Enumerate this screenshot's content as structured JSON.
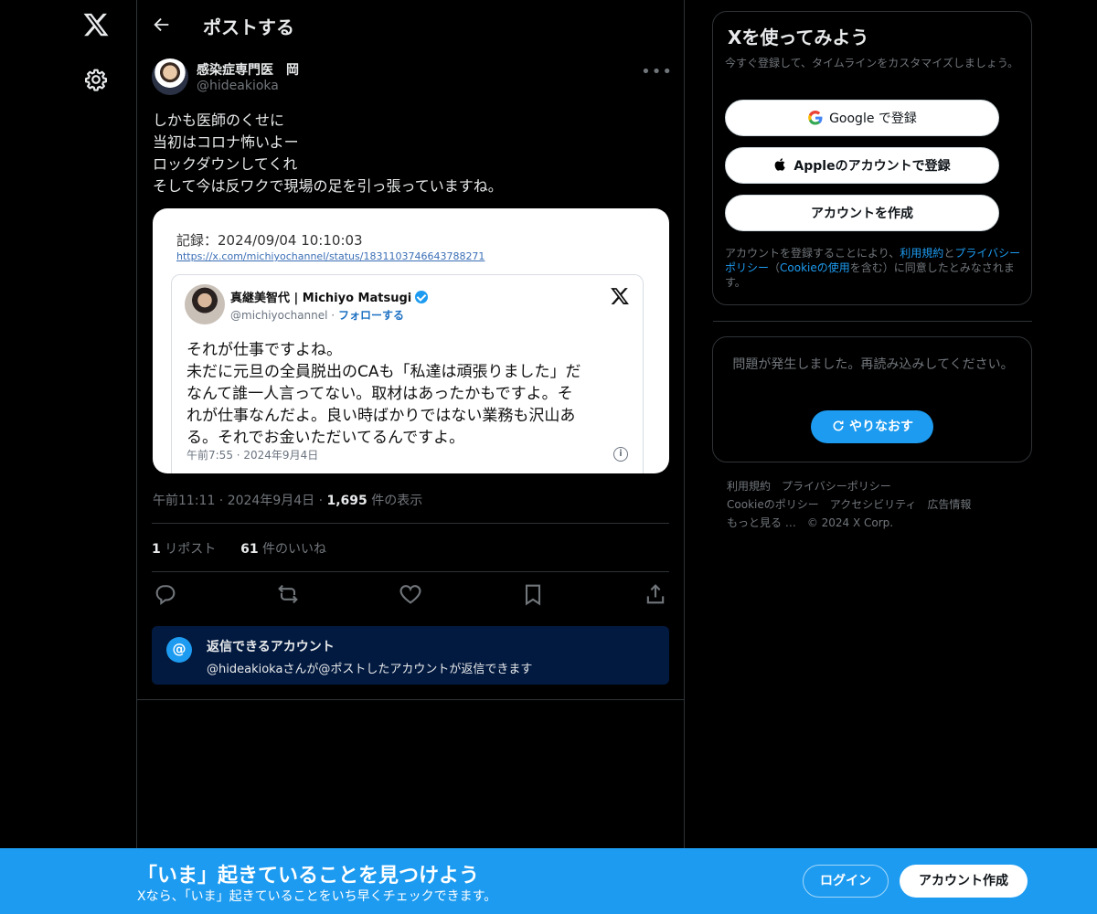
{
  "header": {
    "title": "ポストする"
  },
  "post": {
    "author_name": "感染症専門医　岡",
    "author_handle": "@hideakioka",
    "lines": [
      "しかも医師のくせに",
      "当初はコロナ怖いよー",
      "ロックダウンしてくれ",
      "そして今は反ワクで現場の足を引っ張っていますね。"
    ],
    "meta_time": "午前11:11 · 2024年9月4日 · ",
    "views_count": "1,695",
    "views_label": " 件の表示",
    "reposts_count": "1",
    "reposts_label": " リポスト",
    "likes_count": "61",
    "likes_label": " 件のいいね"
  },
  "media": {
    "record": "記録：2024/09/04 10:10:03",
    "url": "https://x.com/michiyochannel/status/1831103746643788271",
    "name": "真継美智代 | Michiyo Matsugi",
    "handle": "@michiyochannel · ",
    "follow": "フォローする",
    "text_lines": [
      "それが仕事ですよね。",
      "未だに元旦の全員脱出のCAも「私達は頑張りました」だ",
      "なんて誰一人言ってない。取材はあったかもですよ。そ",
      "れが仕事なんだよ。良い時ばかりではない業務も沢山あ",
      "る。それでお金いただいてるんですよ。"
    ],
    "time": "午前7:55 · 2024年9月4日"
  },
  "reply_restriction": {
    "title": "返信できるアカウント",
    "subtitle": "@hideakiokaさんが@ポストしたアカウントが返信できます"
  },
  "signup": {
    "title": "Xを使ってみよう",
    "subtitle": "今すぐ登録して、タイムラインをカスタマイズしましょう。",
    "google_label": "Google で登録",
    "apple_label": "Appleのアカウントで登録",
    "create_label": "アカウントを作成",
    "legal_prefix": "アカウントを登録することにより、",
    "legal_terms": "利用規約",
    "legal_and": "と",
    "legal_privacy": "プライバシーポリシー",
    "legal_paren_open": "（",
    "legal_cookie": "Cookieの使用",
    "legal_suffix": "を含む）に同意したとみなされます。"
  },
  "error": {
    "message": "問題が発生しました。再読み込みしてください。",
    "retry_label": "やりなおす"
  },
  "footer": {
    "links": [
      "利用規約",
      "プライバシーポリシー",
      "Cookieのポリシー",
      "アクセシビリティ",
      "広告情報",
      "もっと見る …",
      "© 2024 X Corp."
    ]
  },
  "banner": {
    "title": "「いま」起きていることを見つけよう",
    "subtitle": "Xなら、「いま」起きていることをいち早くチェックできます。",
    "login_label": "ログイン",
    "create_label": "アカウント作成"
  },
  "colors": {
    "accent": "#1d9bf0",
    "background": "#000000",
    "text": "#e7e9ea",
    "muted": "#71767b",
    "border": "#2f3336"
  }
}
